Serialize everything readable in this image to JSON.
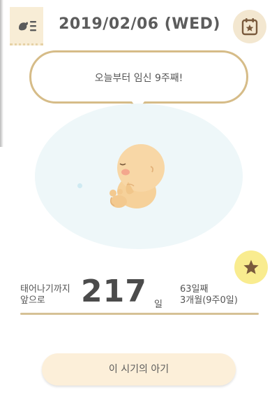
{
  "header": {
    "date": "2019/02/06 (WED)"
  },
  "bubble": {
    "message": "오늘부터 임신 9주째!"
  },
  "countdown": {
    "label_line1": "태어나기까지",
    "label_line2": "앞으로",
    "days_remaining": "217",
    "unit": "일",
    "days_elapsed": "63일째",
    "months_weeks": "3개월(9주0일)"
  },
  "bottom_button": {
    "label": "이 시기의 아기"
  },
  "icons": {
    "menu": "menu-list-icon",
    "calendar": "calendar-star-icon",
    "favorite": "star-icon"
  },
  "colors": {
    "accent_gold": "#d6bc88",
    "tab_bg": "#f8edd6",
    "star_bg": "#f9ec8f",
    "womb_bg": "#eef7f9",
    "button_bg": "#fcefd9"
  }
}
